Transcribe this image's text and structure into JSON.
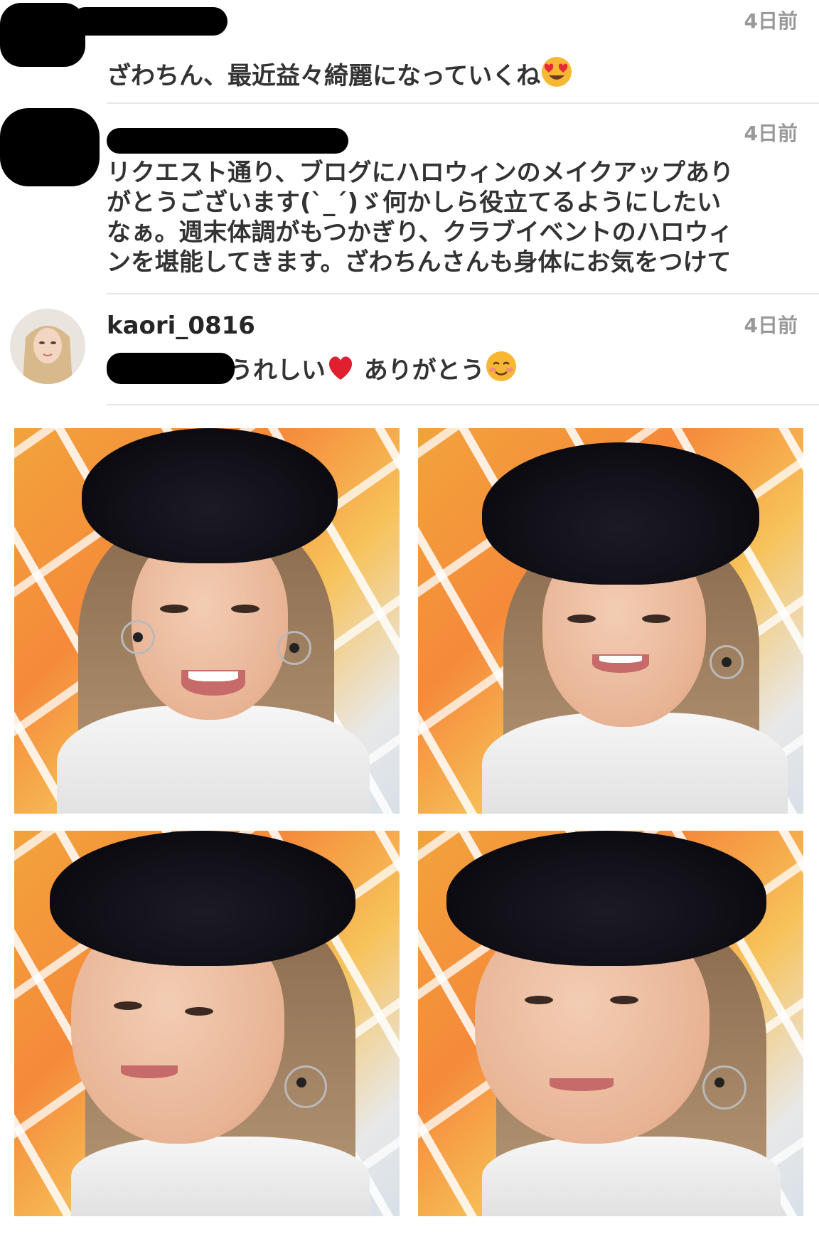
{
  "comments": [
    {
      "username": "",
      "time": "4日前",
      "text": "ざわちん、最近益々綺麗になっていくね",
      "emoji": "heart-eyes-emoji"
    },
    {
      "username": "",
      "time": "4日前",
      "lines": [
        "リクエスト通り、ブログにハロウィンのメイクアップあり",
        "がとうございます(`_´)ゞ何かしら役立てるようにしたい",
        "なぁ。週末体調がもつかぎり、クラブイベントのハロウィ",
        "ンを堪能してきます。ざわちんさんも身体にお気をつけて"
      ]
    },
    {
      "username": "kaori_0816",
      "time": "4日前",
      "text_before": "うれしい",
      "text_after": "ありがとう",
      "emojis": [
        "red-heart-emoji",
        "smiling-emoji"
      ]
    }
  ],
  "photos": [
    {
      "name": "photo-1",
      "expression": "laughing"
    },
    {
      "name": "photo-2",
      "expression": "smiling"
    },
    {
      "name": "photo-3",
      "expression": "side-view"
    },
    {
      "name": "photo-4",
      "expression": "closed-smile"
    }
  ],
  "colors": {
    "username": "#262626",
    "time": "#999999",
    "divider": "#e6e6e6",
    "redaction": "#000000"
  }
}
